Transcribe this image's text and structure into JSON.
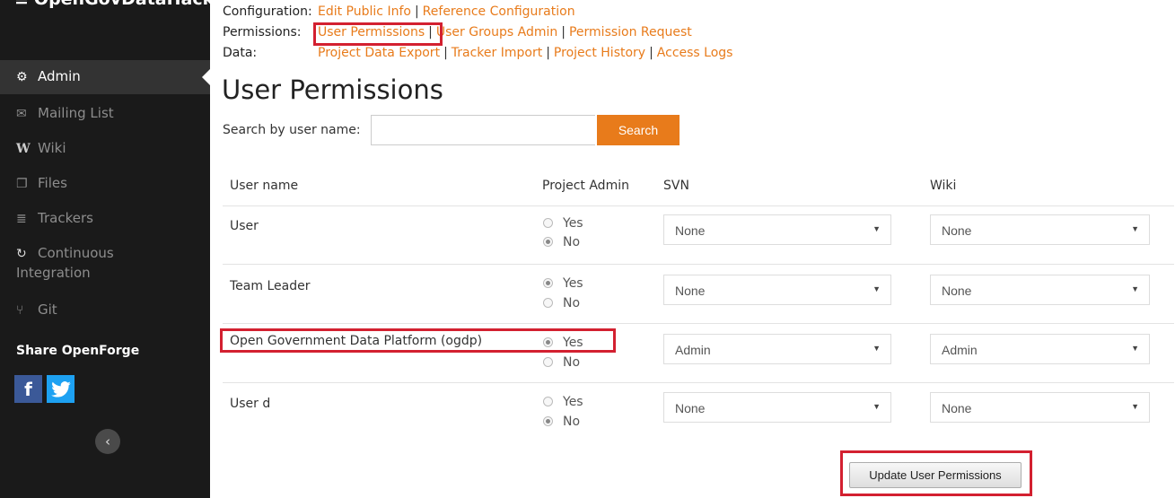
{
  "sidebar": {
    "brand": "OpenGovDataHack",
    "items": [
      {
        "label": "Admin",
        "icon": "cogs-icon",
        "glyph": "⚙"
      },
      {
        "label": "Mailing List",
        "icon": "envelope-icon",
        "glyph": "✉"
      },
      {
        "label": "Wiki",
        "icon": "wikipedia-icon",
        "glyph": "W"
      },
      {
        "label": "Files",
        "icon": "files-icon",
        "glyph": "🗐"
      },
      {
        "label": "Trackers",
        "icon": "list-icon",
        "glyph": "≣"
      },
      {
        "label": "Continuous",
        "label2": "Integration",
        "icon": "refresh-icon",
        "glyph": "↻"
      },
      {
        "label": "Git",
        "icon": "git-icon",
        "glyph": "⑂"
      }
    ],
    "share_title": "Share OpenForge",
    "social": {
      "facebook": "f",
      "twitter": "t"
    },
    "collapse_glyph": "‹"
  },
  "nav": {
    "configuration": {
      "label": "Configuration:",
      "links": [
        "Edit Public Info",
        "Reference Configuration"
      ]
    },
    "permissions": {
      "label": "Permissions:",
      "links": [
        "User Permissions",
        "User Groups Admin",
        "Permission Request"
      ]
    },
    "data": {
      "label": "Data:",
      "links": [
        "Project Data Export",
        "Tracker Import",
        "Project History",
        "Access Logs"
      ]
    },
    "separator": "|"
  },
  "page": {
    "title": "User Permissions",
    "search_label": "Search by user name:",
    "search_value": "",
    "search_button": "Search"
  },
  "table": {
    "headers": [
      "User name",
      "Project Admin",
      "SVN",
      "Wiki"
    ],
    "yes_label": "Yes",
    "no_label": "No",
    "rows": [
      {
        "name": "User",
        "project_admin": "No",
        "svn": "None",
        "wiki": "None"
      },
      {
        "name": "Team Leader",
        "project_admin": "Yes",
        "svn": "None",
        "wiki": "None"
      },
      {
        "name": "Open Government Data Platform (ogdp)",
        "project_admin": "Yes",
        "svn": "Admin",
        "wiki": "Admin"
      },
      {
        "name": "User d",
        "project_admin": "No",
        "svn": "None",
        "wiki": "None"
      }
    ]
  },
  "update_button": "Update User Permissions",
  "colors": {
    "accent": "#e87b1b",
    "highlight": "#d32030",
    "sidebar": "#1a1a1a"
  }
}
